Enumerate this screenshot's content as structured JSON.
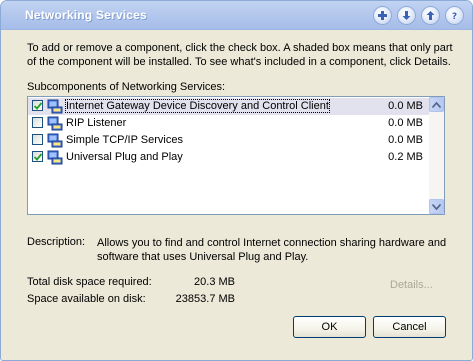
{
  "window": {
    "title": "Networking Services",
    "title_buttons": [
      "plus-icon",
      "arrow-down-icon",
      "arrow-up-icon",
      "help-icon"
    ]
  },
  "dialog": {
    "instructions": "To add or remove a component, click the check box. A shaded box means that only part of the component will be installed. To see what's included in a component, click Details.",
    "subcomponents_label": "Subcomponents of Networking Services:",
    "components": [
      {
        "name": "Internet Gateway Device Discovery and Control Client",
        "size": "0.0 MB",
        "checked": true,
        "selected": true
      },
      {
        "name": "RIP Listener",
        "size": "0.0 MB",
        "checked": false,
        "selected": false
      },
      {
        "name": "Simple TCP/IP Services",
        "size": "0.0 MB",
        "checked": false,
        "selected": false
      },
      {
        "name": "Universal Plug and Play",
        "size": "0.2 MB",
        "checked": true,
        "selected": false
      }
    ],
    "description_label": "Description:",
    "description_text": "Allows you to find and control Internet connection sharing hardware and software that uses Universal Plug and Play.",
    "total_disk_label": "Total disk space required:",
    "total_disk_value": "20.3 MB",
    "available_disk_label": "Space available on disk:",
    "available_disk_value": "23853.7 MB",
    "details_label": "Details...",
    "ok_label": "OK",
    "cancel_label": "Cancel"
  },
  "colors": {
    "title_bar": "#b5c9ee",
    "dialog_bg": "#ece9d8",
    "selection": "#e2e1ee",
    "disabled_text": "#aca899"
  }
}
